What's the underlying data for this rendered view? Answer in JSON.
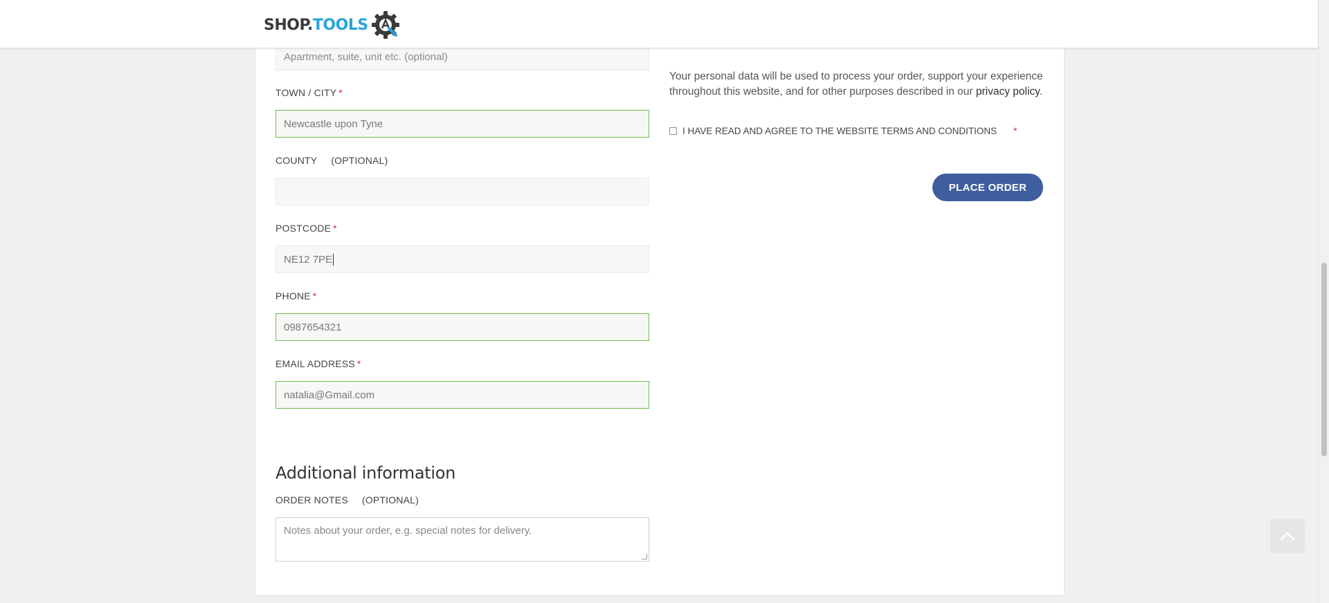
{
  "header": {
    "logo_shop": "SHOP.",
    "logo_tools": "TOOLS"
  },
  "fields": {
    "apartment": {
      "placeholder": "Apartment, suite, unit etc. (optional)",
      "value": ""
    },
    "town": {
      "label": "TOWN / CITY",
      "required": "*",
      "value": "Newcastle upon Tyne"
    },
    "county": {
      "label": "COUNTY",
      "optional": "(OPTIONAL)",
      "value": ""
    },
    "postcode": {
      "label": "POSTCODE",
      "required": "*",
      "value": "NE12 7PE"
    },
    "phone": {
      "label": "PHONE",
      "required": "*",
      "value": "0987654321"
    },
    "email": {
      "label": "EMAIL ADDRESS",
      "required": "*",
      "value": "natalia@Gmail.com"
    }
  },
  "additional": {
    "title": "Additional information",
    "notes_label": "ORDER NOTES",
    "notes_optional": "(OPTIONAL)",
    "notes_placeholder": "Notes about your order, e.g. special notes for delivery."
  },
  "order": {
    "privacy_text": "Your personal data will be used to process your order, support your experience throughout this website, and for other purposes described in our",
    "privacy_link": "privacy policy",
    "privacy_end": ".",
    "terms_label": "I HAVE READ AND AGREE TO THE WEBSITE TERMS AND CONDITIONS",
    "terms_required": "*",
    "terms_checked": false,
    "place_order_label": "PLACE ORDER"
  },
  "colors": {
    "accent_button": "#3f5e9e",
    "valid_border": "#6fbf4a",
    "required_star": "#d9262c",
    "logo_tools": "#2aa3d8"
  },
  "icons": {
    "logo_mark": "gear-wrench-icon",
    "back_to_top": "chevron-up-icon"
  }
}
